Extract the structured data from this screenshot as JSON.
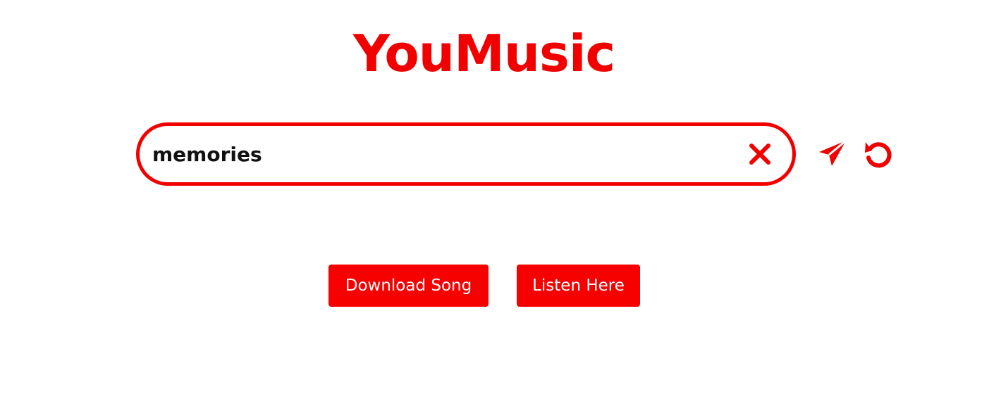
{
  "app": {
    "title": "YouMusic"
  },
  "search": {
    "value": "memories",
    "placeholder": ""
  },
  "icons": {
    "clear": "close-icon",
    "send": "send-icon",
    "reset": "reset-icon"
  },
  "actions": {
    "download_label": "Download Song",
    "listen_label": "Listen Here"
  },
  "colors": {
    "accent": "#f20000",
    "text": "#111111",
    "background": "#ffffff"
  }
}
